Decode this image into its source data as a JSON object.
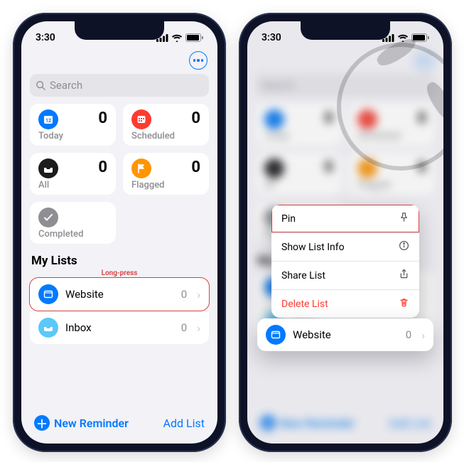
{
  "status": {
    "time": "3:30"
  },
  "search": {
    "placeholder": "Search"
  },
  "cards": {
    "today": {
      "label": "Today",
      "count": "0"
    },
    "scheduled": {
      "label": "Scheduled",
      "count": "0"
    },
    "all": {
      "label": "All",
      "count": "0"
    },
    "flagged": {
      "label": "Flagged",
      "count": "0"
    },
    "completed": {
      "label": "Completed"
    }
  },
  "mylists": {
    "title": "My Lists",
    "annotation": "Long-press",
    "items": [
      {
        "name": "Website",
        "count": "0"
      },
      {
        "name": "Inbox",
        "count": "0"
      }
    ]
  },
  "footer": {
    "new_reminder": "New Reminder",
    "add_list": "Add List"
  },
  "context_menu": {
    "pin": "Pin",
    "info": "Show List Info",
    "share": "Share List",
    "delete": "Delete List"
  },
  "context_preview": {
    "name": "Website",
    "count": "0"
  },
  "colors": {
    "today": "#007aff",
    "scheduled": "#ff3b30",
    "all": "#1c1c1e",
    "flagged": "#ff9500",
    "completed": "#8e8e93",
    "list_website": "#007aff",
    "list_inbox": "#5ac8fa"
  }
}
